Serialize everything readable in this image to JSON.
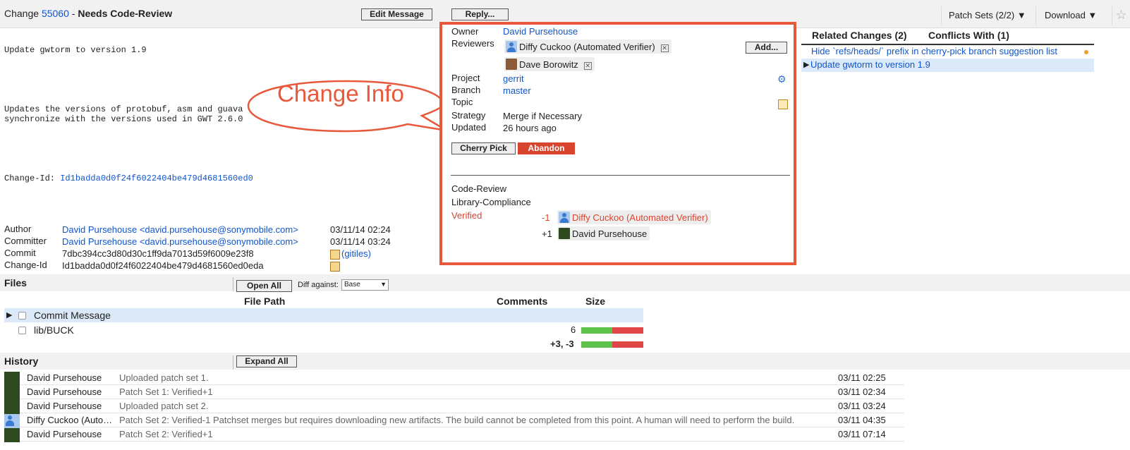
{
  "header": {
    "change_label": "Change",
    "change_number": "55060",
    "separator": " - ",
    "status": "Needs Code-Review",
    "edit_message": "Edit Message",
    "reply": "Reply...",
    "patch_sets": "Patch Sets (2/2) ▼",
    "download": "Download ▼",
    "star": "☆"
  },
  "commit_message": {
    "subject": "Update gwtorm to version 1.9",
    "body": "Updates the versions of protobuf, asm and guava libraries to\nsynchronize with the versions used in GWT 2.6.0",
    "change_id_label": "Change-Id: ",
    "change_id": "Id1badda0d0f24f6022404be479d4681560ed0"
  },
  "callout": {
    "text": "Change Info"
  },
  "info": {
    "owner_label": "Owner",
    "owner": "David Pursehouse",
    "reviewers_label": "Reviewers",
    "reviewers": [
      "Diffy Cuckoo (Automated Verifier)",
      "Dave Borowitz"
    ],
    "add_button": "Add...",
    "project_label": "Project",
    "project": "gerrit",
    "branch_label": "Branch",
    "branch": "master",
    "topic_label": "Topic",
    "strategy_label": "Strategy",
    "strategy": "Merge if Necessary",
    "updated_label": "Updated",
    "updated": "26 hours ago",
    "cherry_pick": "Cherry Pick",
    "abandon": "Abandon",
    "labels": {
      "code_review": "Code-Review",
      "library_compliance": "Library-Compliance",
      "verified": "Verified",
      "votes": [
        {
          "score": "-1",
          "name": "Diffy Cuckoo (Automated Verifier)"
        },
        {
          "score": "+1",
          "name": "David Pursehouse"
        }
      ]
    },
    "colors": {
      "highlight": "#e8593c",
      "negative": "#d9442f"
    }
  },
  "related": {
    "tab_related": "Related Changes (2)",
    "tab_conflicts": "Conflicts With (1)",
    "items": [
      "Hide `refs/heads/` prefix in cherry-pick branch suggestion list",
      "Update gwtorm to version 1.9"
    ]
  },
  "meta": {
    "author_label": "Author",
    "author": "David Pursehouse <david.pursehouse@sonymobile.com>",
    "author_date": "03/11/14 02:24",
    "committer_label": "Committer",
    "committer": "David Pursehouse <david.pursehouse@sonymobile.com>",
    "committer_date": "03/11/14 03:24",
    "commit_label": "Commit",
    "commit": "7dbc394cc3d80d30c1ff9da7013d59f6009e23f8",
    "gitiles": "(gitiles)",
    "change_id_label": "Change-Id",
    "change_id": "Id1badda0d0f24f6022404be479d4681560ed0eda"
  },
  "files": {
    "title": "Files",
    "open_all": "Open All",
    "diff_against_label": "Diff against:",
    "diff_against_value": "Base",
    "col_path": "File Path",
    "col_comments": "Comments",
    "col_size": "Size",
    "rows": [
      {
        "path": "Commit Message",
        "size": ""
      },
      {
        "path": "lib/BUCK",
        "size": "6"
      }
    ],
    "total": "+3, -3"
  },
  "history": {
    "title": "History",
    "expand_all": "Expand All",
    "rows": [
      {
        "name": "David Pursehouse",
        "msg": "Uploaded patch set 1.",
        "date": "03/11 02:25"
      },
      {
        "name": "David Pursehouse",
        "msg": "Patch Set 1: Verified+1",
        "date": "03/11 02:34"
      },
      {
        "name": "David Pursehouse",
        "msg": "Uploaded patch set 2.",
        "date": "03/11 03:24"
      },
      {
        "name": "Diffy Cuckoo (Automated Verifier)",
        "msg": "Patch Set 2: Verified-1 Patchset merges but requires downloading new artifacts. The build cannot be completed from this point. A human will need to perform the build.",
        "date": "03/11 04:35"
      },
      {
        "name": "David Pursehouse",
        "msg": "Patch Set 2: Verified+1",
        "date": "03/11 07:14"
      }
    ]
  }
}
